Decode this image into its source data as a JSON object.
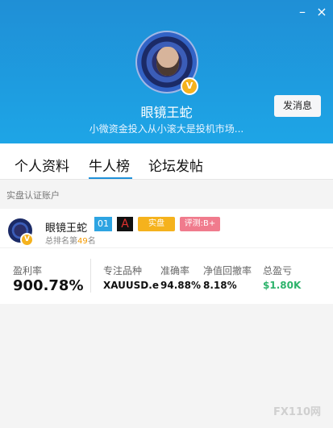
{
  "profile": {
    "name": "眼镜王蛇",
    "signature": "小微资金投入从小滚大是投机市场...",
    "message_button": "发消息"
  },
  "tabs": [
    "个人资料",
    "牛人榜",
    "论坛发帖"
  ],
  "active_tab": "牛人榜",
  "section_title": "实盘认证账户",
  "trader": {
    "name": "眼镜王蛇",
    "level_tag": "01",
    "broker_tag": "A",
    "real_tag": "实盘",
    "evaluation_tag": "评测:B+",
    "rank_prefix": "总排名第",
    "rank_value": "49",
    "rank_suffix": "名"
  },
  "stats": {
    "profit_rate_label": "盈利率",
    "profit_rate_value": "900.78%",
    "items": [
      {
        "label": "专注品种",
        "value": "XAUUSD.e"
      },
      {
        "label": "准确率",
        "value": "94.88%"
      },
      {
        "label": "净值回撤率",
        "value": "8.18%"
      },
      {
        "label": "总盈亏",
        "value": "$1.80K"
      }
    ]
  },
  "window_controls": {
    "minimize": "–",
    "close": "×"
  },
  "watermark": "FX110网",
  "colors": {
    "header": "#1ea5e6",
    "accent": "#1e90d8",
    "profit": "#2db36b"
  }
}
